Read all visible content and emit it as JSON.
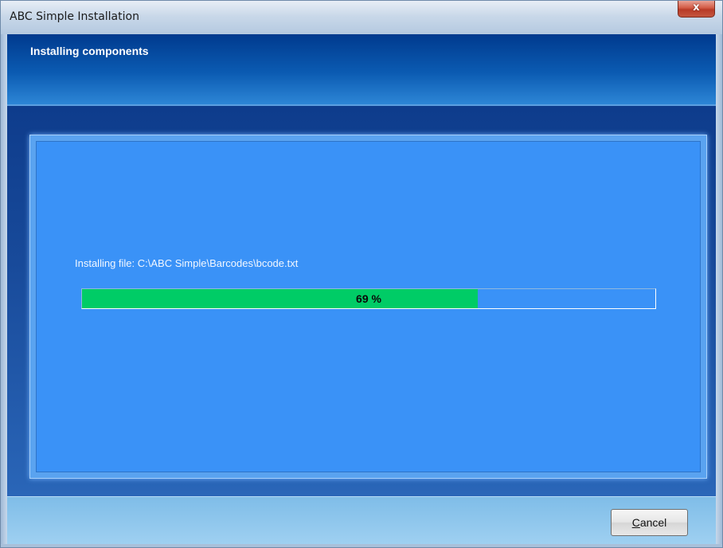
{
  "window": {
    "title": "ABC Simple Installation",
    "close_symbol": "x",
    "close_icon": "close-icon"
  },
  "header": {
    "title": "Installing components"
  },
  "status": {
    "label": "Installing file: C:\\ABC Simple\\Barcodes\\bcode.txt"
  },
  "progress": {
    "percent": 69,
    "text": "69 %",
    "fill_color": "#00cc66"
  },
  "footer": {
    "cancel_mnemonic": "C",
    "cancel_rest": "ancel"
  },
  "colors": {
    "panel": "#3a92f7",
    "header_band": "#0b5bb2",
    "close_button": "#c4553f"
  }
}
